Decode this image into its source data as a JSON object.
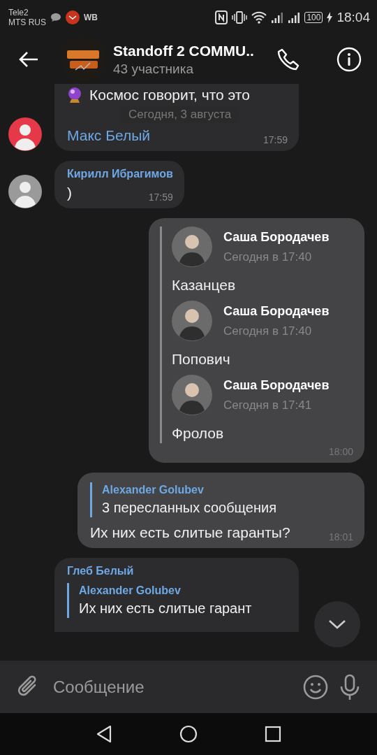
{
  "status_bar": {
    "carrier_1": "Tele2",
    "carrier_2": "MTS RUS",
    "app_label": "WB",
    "battery": "100",
    "time": "18:04"
  },
  "header": {
    "title": "Standoff 2 COMMU..",
    "subtitle": "43 участника"
  },
  "date_pill": "Сегодня, 3 августа",
  "messages": [
    {
      "kind": "incoming",
      "avatar": true,
      "lines": [
        "Космос говорит, что это"
      ],
      "mention": "Макс Белый",
      "time": "17:59"
    },
    {
      "kind": "incoming",
      "avatar": true,
      "sender": "Кирилл Ибрагимов",
      "text": ")",
      "time": "17:59"
    },
    {
      "kind": "outgoing",
      "forwarded": [
        {
          "sender": "Саша Бородачев",
          "date": "Сегодня в 17:40",
          "text": "Казанцев"
        },
        {
          "sender": "Саша Бородачев",
          "date": "Сегодня в 17:40",
          "text": "Попович"
        },
        {
          "sender": "Саша Бородачев",
          "date": "Сегодня в 17:41",
          "text": "Фролов"
        }
      ],
      "time": "18:00"
    },
    {
      "kind": "outgoing",
      "reply": {
        "sender": "Alexander Golubev",
        "text": "3 пересланных сообщения"
      },
      "text": "Их них есть слитые гаранты?",
      "time": "18:01"
    },
    {
      "kind": "incoming",
      "avatar": false,
      "sender": "Глеб Белый",
      "reply": {
        "sender": "Alexander Golubev",
        "text": "Их них есть слитые гарант"
      }
    }
  ],
  "composer": {
    "placeholder": "Сообщение"
  }
}
